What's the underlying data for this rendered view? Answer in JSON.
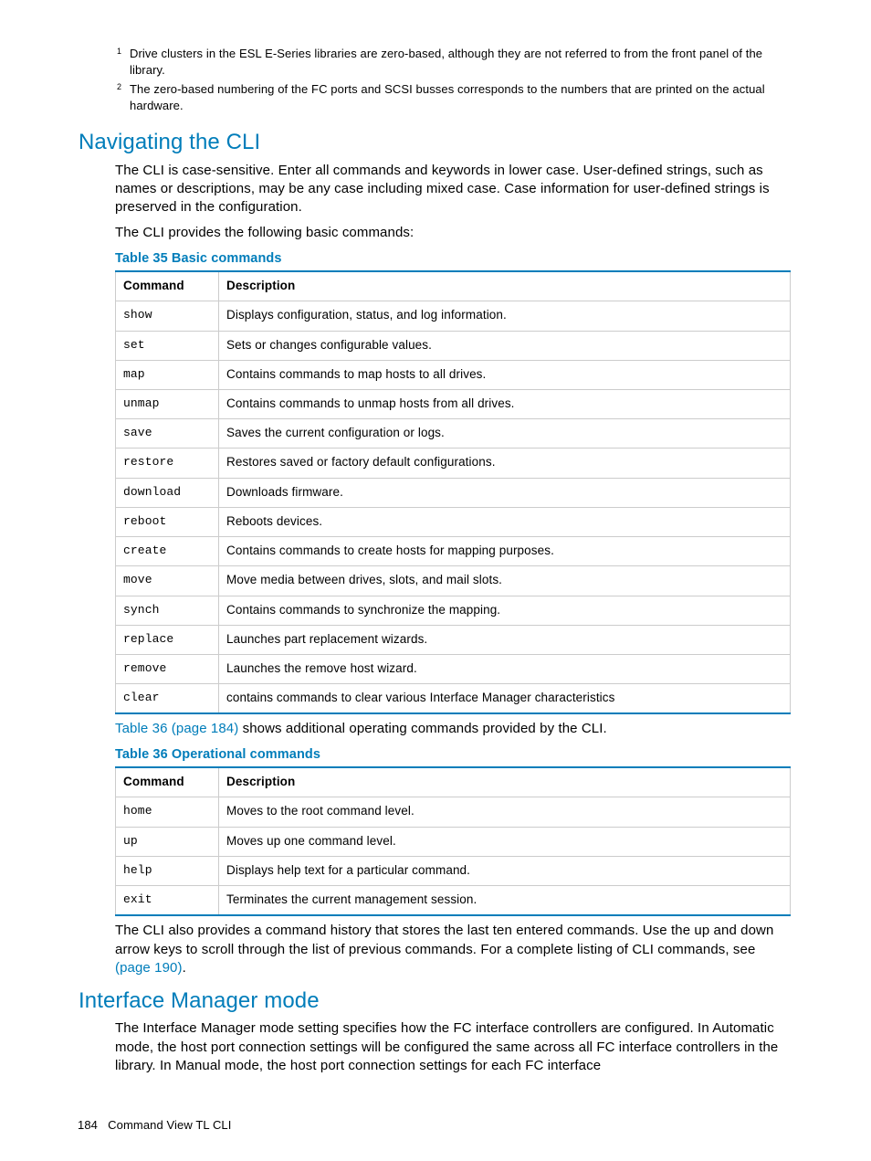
{
  "footnotes": [
    {
      "num": "1",
      "text": "Drive clusters in the ESL E-Series libraries are zero-based, although they are not referred to from the front panel of the library."
    },
    {
      "num": "2",
      "text": "The zero-based numbering of the FC ports and SCSI busses corresponds to the numbers that are printed on the actual hardware."
    }
  ],
  "sections": {
    "nav_cli": {
      "heading": "Navigating the CLI",
      "para1": "The CLI is case-sensitive. Enter all commands and keywords in lower case. User-defined strings, such as names or descriptions, may be any case including mixed case. Case information for user-defined strings is preserved in the configuration.",
      "para2": "The CLI provides the following basic commands:",
      "table35_caption": "Table 35 Basic commands",
      "col_cmd": "Command",
      "col_desc": "Description",
      "table35_rows": [
        {
          "cmd": "show",
          "desc": "Displays configuration, status, and log information."
        },
        {
          "cmd": "set",
          "desc": "Sets or changes configurable values."
        },
        {
          "cmd": "map",
          "desc": "Contains commands to map hosts to all drives."
        },
        {
          "cmd": "unmap",
          "desc": "Contains commands to unmap hosts from all drives."
        },
        {
          "cmd": "save",
          "desc": "Saves the current configuration or logs."
        },
        {
          "cmd": "restore",
          "desc": "Restores saved or factory default configurations."
        },
        {
          "cmd": "download",
          "desc": "Downloads firmware."
        },
        {
          "cmd": "reboot",
          "desc": "Reboots devices."
        },
        {
          "cmd": "create",
          "desc": "Contains commands to create hosts for mapping purposes."
        },
        {
          "cmd": "move",
          "desc": "Move media between drives, slots, and mail slots."
        },
        {
          "cmd": "synch",
          "desc": "Contains commands to synchronize the mapping."
        },
        {
          "cmd": "replace",
          "desc": "Launches part replacement wizards."
        },
        {
          "cmd": "remove",
          "desc": "Launches the remove host wizard."
        },
        {
          "cmd": "clear",
          "desc": "contains commands to clear various Interface Manager characteristics"
        }
      ],
      "para3_link": "Table 36 (page 184)",
      "para3_rest": " shows additional operating commands provided by the CLI.",
      "table36_caption": "Table 36 Operational commands",
      "table36_rows": [
        {
          "cmd": "home",
          "desc": "Moves to the root command level."
        },
        {
          "cmd": "up",
          "desc": "Moves up one command level."
        },
        {
          "cmd": "help",
          "desc": "Displays help text for a particular command."
        },
        {
          "cmd": "exit",
          "desc": "Terminates the current management session."
        }
      ],
      "para4_a": "The CLI also provides a command history that stores the last ten entered commands. Use the up and down arrow keys to scroll through the list of previous commands. For a complete listing of CLI commands, see ",
      "para4_link": "(page 190)",
      "para4_b": "."
    },
    "ifm_mode": {
      "heading": "Interface Manager mode",
      "para1": "The Interface Manager mode setting specifies how the FC interface controllers are configured. In Automatic mode, the host port connection settings will be configured the same across all FC interface controllers in the library. In Manual mode, the host port connection settings for each FC interface"
    }
  },
  "footer": {
    "page": "184",
    "label": "Command View TL CLI"
  }
}
